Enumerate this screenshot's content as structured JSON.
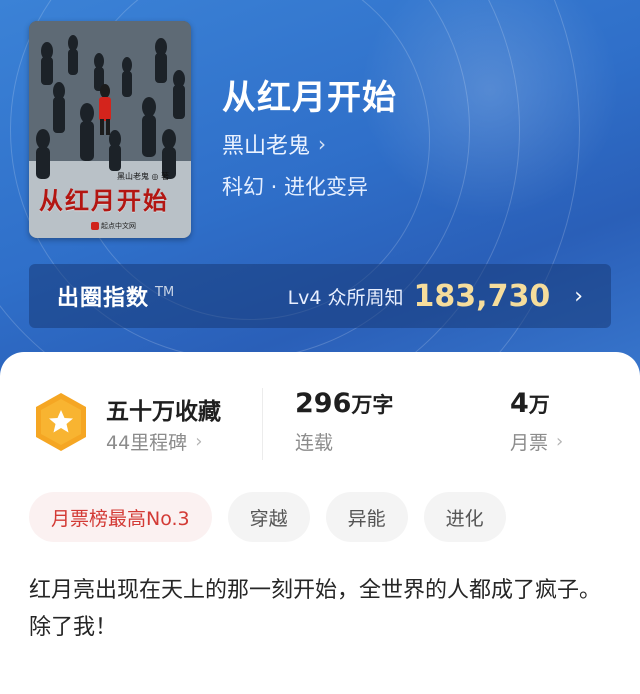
{
  "book": {
    "title": "从红月开始",
    "author": "黑山老鬼",
    "genre": "科幻 · 进化变异",
    "cover": {
      "author_mini": "黑山老鬼 ◎ 著",
      "title_art": "从红月开始",
      "publisher": "起点中文网"
    }
  },
  "index": {
    "label": "出圈指数",
    "tm": "TM",
    "level": "Lv4 众所周知",
    "value": "183,730"
  },
  "stats": {
    "collection": {
      "main": "五十万收藏",
      "sub": "44里程碑"
    },
    "words": {
      "number": "296",
      "unit": "万字",
      "sub": "连载"
    },
    "tickets": {
      "number": "4",
      "unit": "万",
      "sub": "月票"
    }
  },
  "tags": [
    "月票榜最高No.3",
    "穿越",
    "异能",
    "进化"
  ],
  "description": {
    "line1": "红月亮出现在天上的那一刻开始，全世界的人都成了疯子。",
    "line2": "除了我！"
  },
  "colors": {
    "hero": "#2f6fc9",
    "index_value": "#f6dd9c",
    "rank_tag": "#d33a35",
    "badge": "#f5a623"
  }
}
